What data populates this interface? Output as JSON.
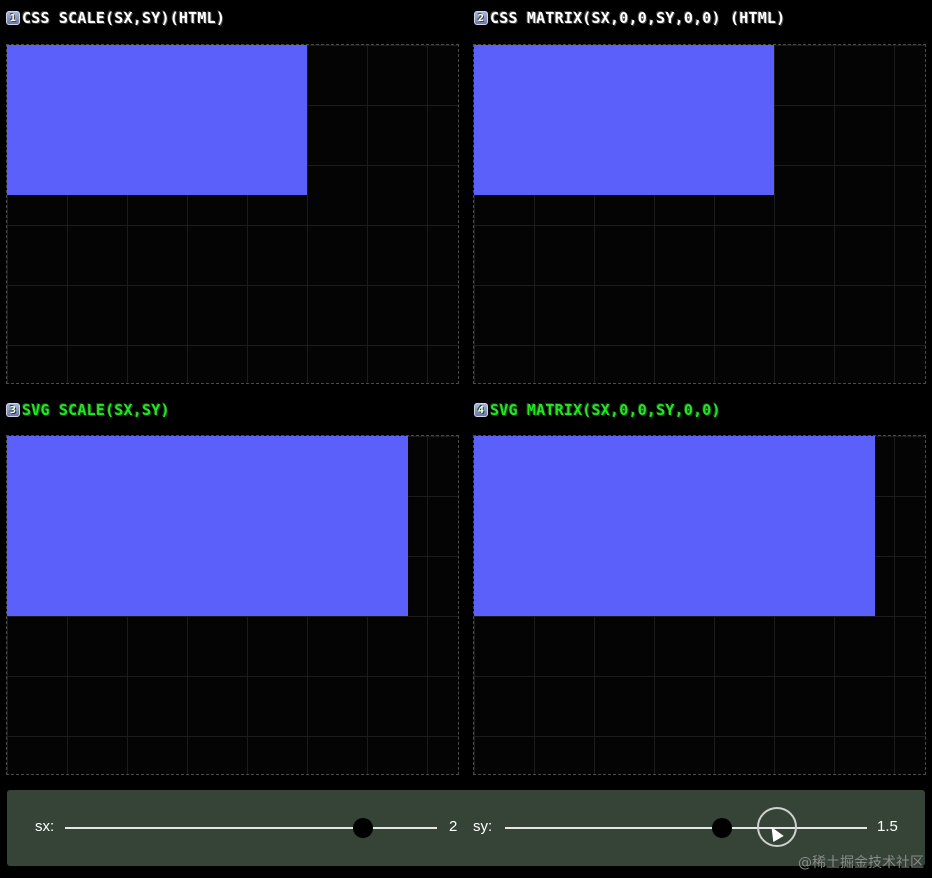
{
  "panels": [
    {
      "badge": "1",
      "title": "CSS SCALE(SX,SY)(HTML)",
      "title_color": "#ffffff"
    },
    {
      "badge": "2",
      "title": "CSS MATRIX(SX,0,0,SY,0,0) (HTML)",
      "title_color": "#ffffff"
    },
    {
      "badge": "3",
      "title": "SVG SCALE(SX,SY)",
      "title_color": "#27e227"
    },
    {
      "badge": "4",
      "title": "SVG MATRIX(SX,0,0,SY,0,0)",
      "title_color": "#27e227"
    }
  ],
  "controls": {
    "sx": {
      "label": "sx:",
      "value": "2",
      "min": 0,
      "max": 2.5,
      "level": 2
    },
    "sy": {
      "label": "sy:",
      "value": "1.5",
      "min": 0,
      "max": 2.5,
      "level": 1.5
    }
  },
  "watermark": "@稀土掘金技术社区",
  "colors": {
    "rect_fill": "#5b60fa",
    "controls_bg": "#354436",
    "background": "#000000"
  }
}
